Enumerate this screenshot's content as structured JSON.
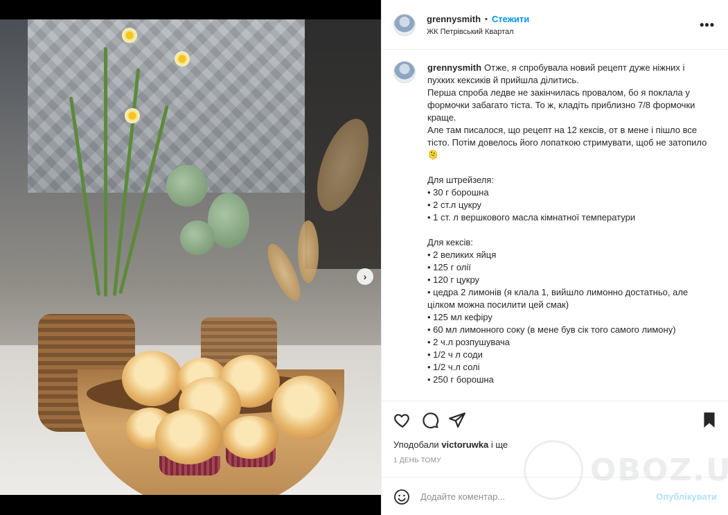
{
  "post": {
    "username": "grennysmith",
    "separator": "•",
    "follow_label": "Стежити",
    "location": "ЖК Петрівський Квартал",
    "more_label": "•••"
  },
  "caption": {
    "username": "grennysmith",
    "text": "Отже, я спробувала новий рецепт дуже ніжних і пухких кексиків й прийшла ділитись.\nПерша спроба ледве не закінчилась провалом, бо я поклала у формочки забагато тіста. То ж, кладіть приблизно 7/8 формочки краще.\nАле там писалося, що рецепт на 12 кексів, от в мене і пішло все тісто. Потім довелось його лопаткою стримувати, щоб не затопило 🫠\n\nДля штрейзеля:\n• 30 г борошна\n• 2 ст.л цукру\n• 1 ст. л вершкового масла кімнатної температури\n\nДля кексів:\n• 2 великих яйця\n• 125 г олії\n• 120 г цукру\n• цедра 2 лимонів (я клала 1, вийшло лимонно достатньо, але цілком можна посилити цей смак)\n• 125 мл кефіру\n• 60 мл лимонного соку (в мене був сік того самого лимону)\n• 2 ч.л розпушувача\n• 1/2 ч л соди\n• 1/2 ч.л солі\n• 250 г борошна"
  },
  "likes": {
    "prefix": "Уподобали",
    "user": "victoruwka",
    "suffix": "і ще"
  },
  "timestamp": "1 ДЕНЬ ТОМУ",
  "comment": {
    "placeholder": "Додайте коментар...",
    "publish_label": "Опублікувати"
  },
  "carousel": {
    "next_label": "›",
    "current_slide": 1,
    "total_slides": 2
  },
  "watermark": {
    "text": "OBOZ.UA"
  },
  "colors": {
    "accent": "#0095f6",
    "publish_disabled": "#b2dffc",
    "text": "#262626",
    "muted": "#8e8e8e"
  },
  "icons": {
    "like": "heart-icon",
    "comment": "comment-icon",
    "share": "paper-plane-icon",
    "save": "bookmark-icon",
    "emoji": "smiley-icon",
    "more": "more-icon",
    "next": "chevron-right-icon"
  }
}
